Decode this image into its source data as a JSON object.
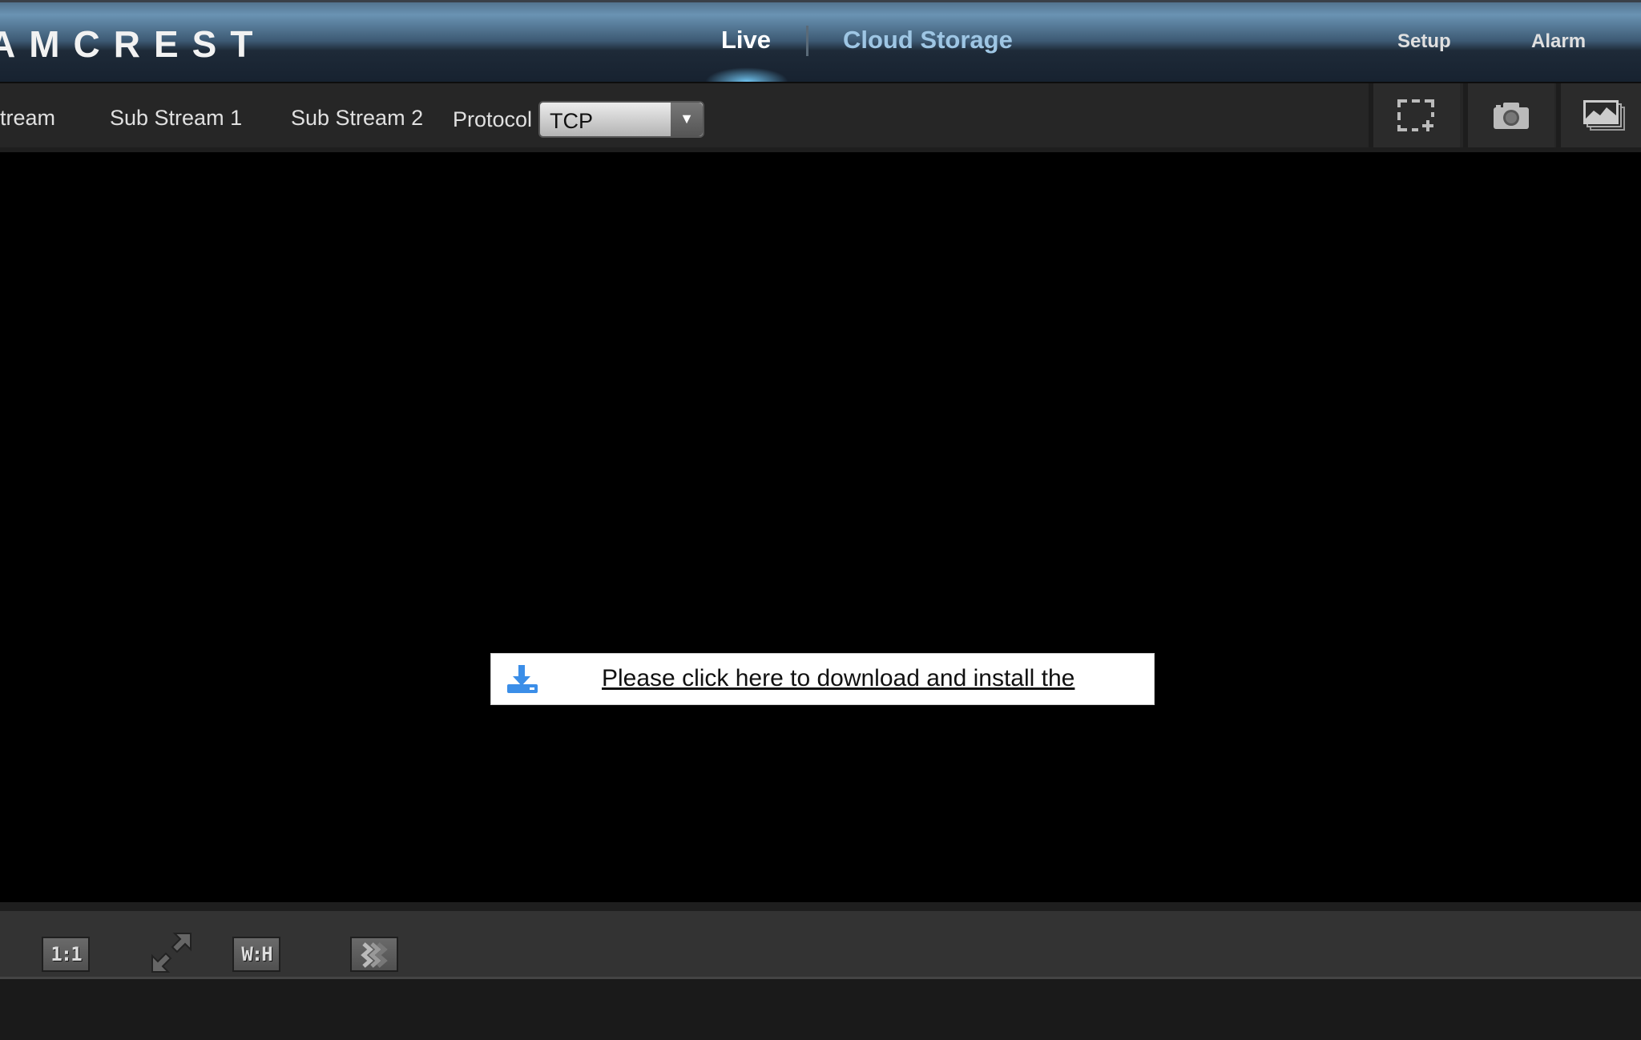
{
  "header": {
    "logo": "AMCREST",
    "nav": [
      {
        "label": "Live",
        "active": true
      },
      {
        "label": "Cloud Storage"
      }
    ],
    "right_nav": [
      {
        "label": "Setup"
      },
      {
        "label": "Alarm"
      }
    ]
  },
  "toolbar": {
    "streams": [
      "tream",
      "Sub Stream 1",
      "Sub Stream 2"
    ],
    "protocol_label": "Protocol",
    "protocol_value": "TCP",
    "tools": [
      "region-zoom-icon",
      "camera-icon",
      "gallery-icon"
    ]
  },
  "video": {
    "download_message": "Please click here to download and install the"
  },
  "bottombar": {
    "buttons": [
      {
        "label": "1:1",
        "icon": "original-size-icon"
      },
      {
        "label": "",
        "icon": "fullscreen-icon"
      },
      {
        "label": "W:H",
        "icon": "aspect-ratio-icon"
      },
      {
        "label": "",
        "icon": "fluency-icon"
      }
    ]
  },
  "colors": {
    "accent": "#6fc3f0",
    "cloud_storage": "#9ec6e4",
    "download_icon": "#3b8ee8"
  }
}
